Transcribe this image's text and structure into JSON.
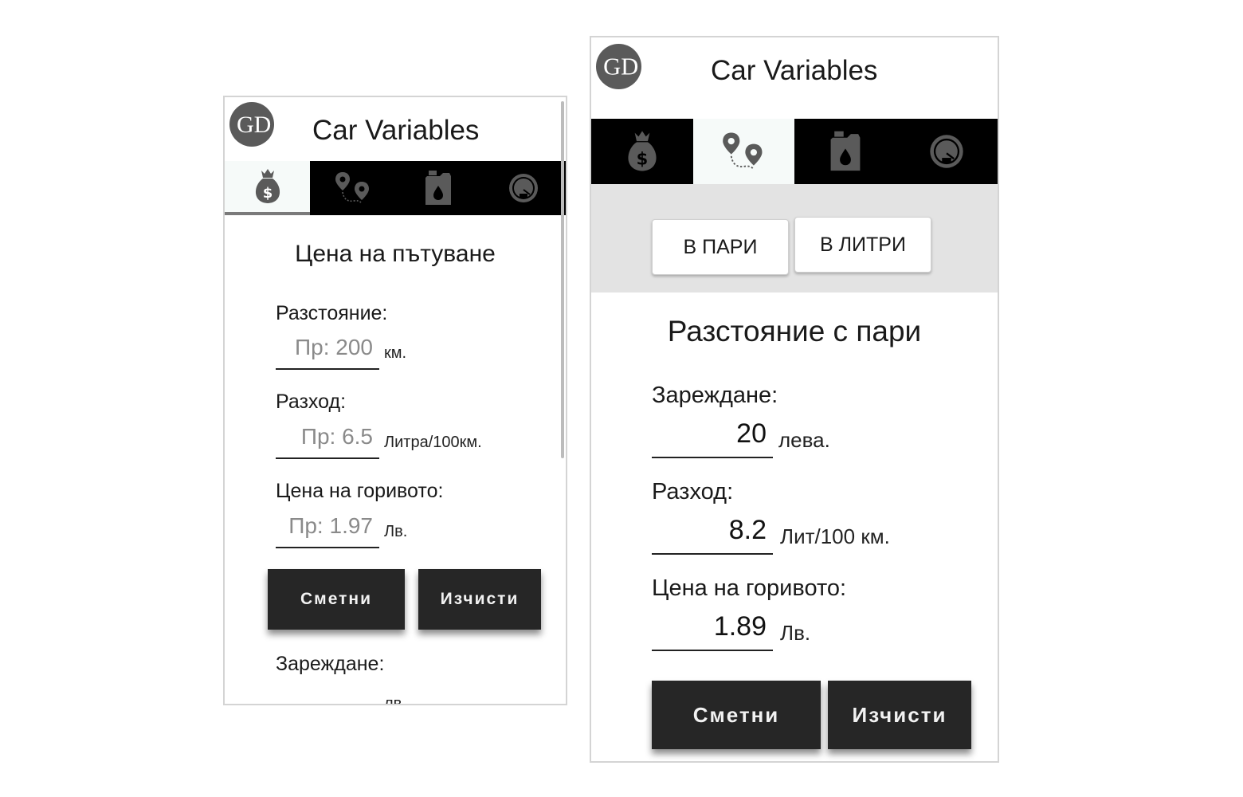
{
  "screen1": {
    "app_title": "Car Variables",
    "logo_letters": "GD",
    "tabs": [
      {
        "icon": "money-bag-icon",
        "active": true
      },
      {
        "icon": "route-pins-icon",
        "active": false
      },
      {
        "icon": "fuel-canister-icon",
        "active": false
      },
      {
        "icon": "speedometer-icon",
        "active": false
      }
    ],
    "heading": "Цена на пътуване",
    "fields": [
      {
        "label": "Разстояние:",
        "placeholder": "Пр: 200",
        "unit": "км."
      },
      {
        "label": "Разход:",
        "placeholder": "Пр: 6.5",
        "unit": "Литра/100км."
      },
      {
        "label": "Цена на горивото:",
        "placeholder": "Пр: 1.97",
        "unit": "Лв."
      }
    ],
    "calc_button": "Сметни",
    "clear_button": "Изчисти",
    "result_label": "Зареждане:",
    "result_unit": "лв."
  },
  "screen2": {
    "app_title": "Car Variables",
    "logo_letters": "GD",
    "tabs": [
      {
        "icon": "money-bag-icon",
        "active": false
      },
      {
        "icon": "route-pins-icon",
        "active": true
      },
      {
        "icon": "fuel-canister-icon",
        "active": false
      },
      {
        "icon": "speedometer-icon",
        "active": false
      }
    ],
    "segment_buttons": [
      "В ПАРИ",
      "В ЛИТРИ"
    ],
    "heading": "Разстояние с пари",
    "fields": [
      {
        "label": "Зареждане:",
        "value": "20",
        "unit": "лева."
      },
      {
        "label": "Разход:",
        "value": "8.2",
        "unit": "Лит/100 км."
      },
      {
        "label": "Цена на горивото:",
        "value": "1.89",
        "unit": "Лв."
      }
    ],
    "calc_button": "Сметни",
    "clear_button": "Изчисти"
  },
  "colors": {
    "tabbar": "#000000",
    "button": "#262626",
    "segment_bg": "#e3e3e3",
    "icon": "#5a5a5a"
  }
}
